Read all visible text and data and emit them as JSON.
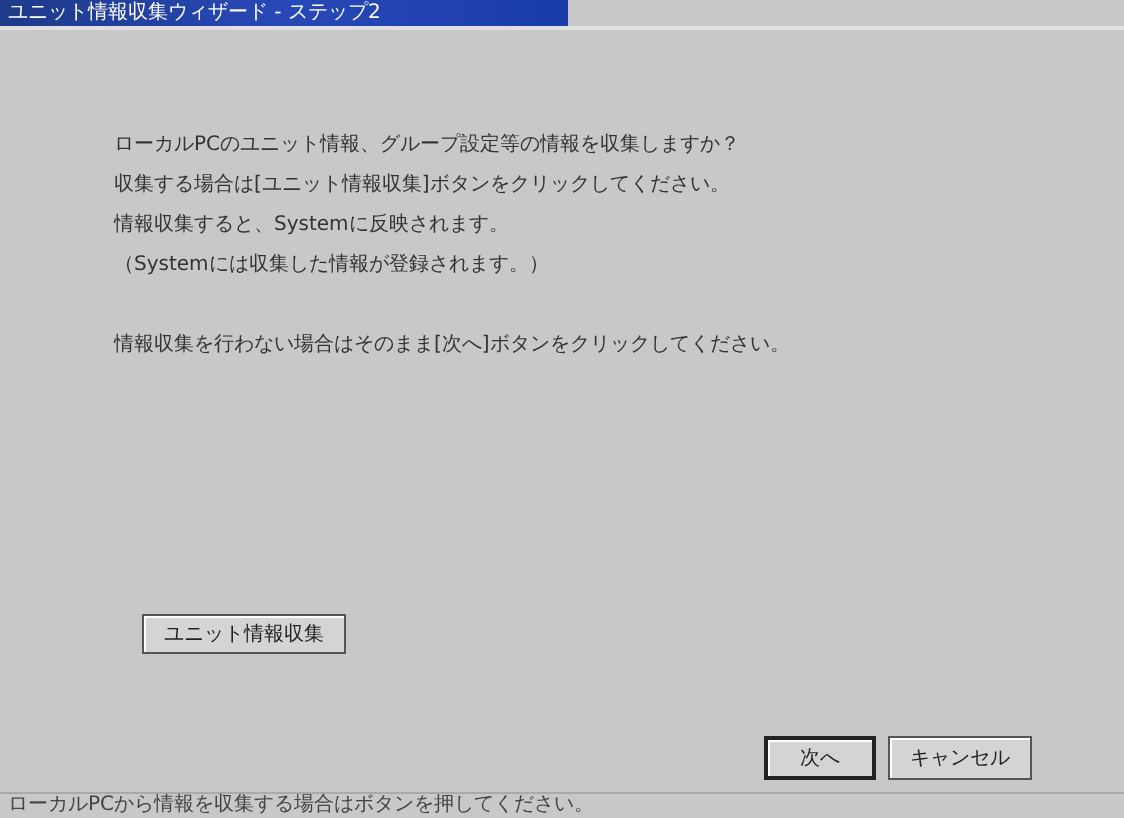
{
  "window": {
    "title": "ユニット情報収集ウィザード - ステップ2"
  },
  "messages": [
    "ローカルPCのユニット情報、グループ設定等の情報を収集しますか？",
    "収集する場合は[ユニット情報収集]ボタンをクリックしてください。",
    "情報収集すると、Systemに反映されます。",
    "（Systemには収集した情報が登録されます。）",
    "情報収集を行わない場合はそのまま[次へ]ボタンをクリックしてください。"
  ],
  "collect_button": "ユニット情報収集",
  "buttons": [
    {
      "label": "次へ",
      "default": true
    },
    {
      "label": "キャンセル",
      "default": false
    }
  ],
  "status_bar": "ローカルPCから情報を収集する場合はボタンを押してください。"
}
